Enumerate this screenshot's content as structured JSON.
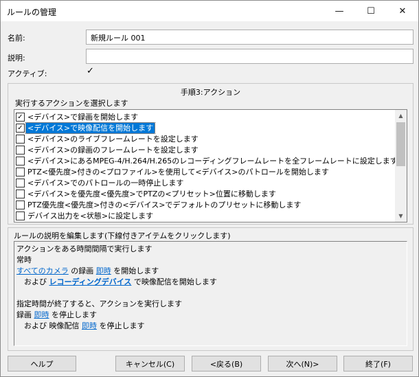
{
  "window": {
    "title": "ルールの管理",
    "minimize_glyph": "—",
    "maximize_glyph": "☐",
    "close_glyph": "✕"
  },
  "form": {
    "name_label": "名前:",
    "name_value": "新規ルール 001",
    "desc_label": "説明:",
    "desc_value": "",
    "active_label": "アクティブ:",
    "active_checked": "✓"
  },
  "step": {
    "title": "手順3:アクション",
    "select_label": "実行するアクションを選択します"
  },
  "actions": [
    {
      "label": "<デバイス>で録画を開始します",
      "check": "✓"
    },
    {
      "label": "<デバイス>で映像配信を開始します",
      "check": "✓"
    },
    {
      "label": "<デバイス>のライブフレームレートを設定します",
      "check": ""
    },
    {
      "label": "<デバイス>の録画のフレームレートを設定します",
      "check": ""
    },
    {
      "label": "<デバイス>にあるMPEG-4/H.264/H.265のレコーディングフレームレートを全フレームレートに設定します",
      "check": ""
    },
    {
      "label": "PTZ<優先度>付きの<プロファイル>を使用して<デバイス>のパトロールを開始します",
      "check": ""
    },
    {
      "label": "<デバイス>でのパトロールの一時停止します",
      "check": ""
    },
    {
      "label": "<デバイス>を優先度<優先度>でPTZの<プリセット>位置に移動します",
      "check": ""
    },
    {
      "label": "PTZ優先度<優先度>付きの<デバイス>でデフォルトのプリセットに移動します",
      "check": ""
    },
    {
      "label": "デバイス出力を<状態>に設定します",
      "check": ""
    }
  ],
  "rule_desc": {
    "header": "ルールの説明を編集します(下線付きアイテムをクリックします)",
    "line1": "アクションをある時間間隔で実行します",
    "line2": "常時",
    "line3_link1": "すべてのカメラ",
    "line3_text1": "の録画",
    "line3_link2": "即時",
    "line3_text2": "を開始します",
    "line4_text1": "および",
    "line4_link1": "レコーディングデバイス",
    "line4_text2": "で映像配信を開始します",
    "line5": "指定時間が終了すると、アクションを実行します",
    "line6_text1": "録画",
    "line6_link1": "即時",
    "line6_text2": "を停止します",
    "line7_text1": "および 映像配信",
    "line7_link1": "即時",
    "line7_text2": "を停止します"
  },
  "buttons": {
    "help": "ヘルプ",
    "cancel": "キャンセル(C)",
    "back": "<戻る(B)",
    "next": "次へ(N)>",
    "finish": "終了(F)"
  },
  "scrollbar": {
    "up_glyph": "▲",
    "down_glyph": "▼"
  }
}
